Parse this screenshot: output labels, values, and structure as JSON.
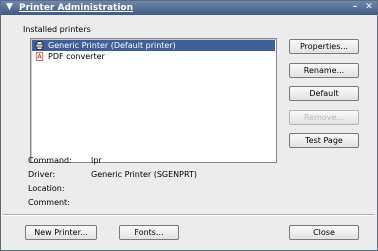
{
  "window": {
    "title": "Printer Administration",
    "minimize_label": "–",
    "close_label": "✕"
  },
  "installed_printers_label": "Installed printers",
  "printers": [
    {
      "name": "Generic Printer (Default printer)",
      "icon": "printer-icon",
      "selected": true
    },
    {
      "name": "PDF converter",
      "icon": "pdf-icon",
      "selected": false
    }
  ],
  "actions": {
    "properties": "Properties...",
    "rename": "Rename...",
    "default": "Default",
    "remove": "Remove...",
    "test_page": "Test Page"
  },
  "details": {
    "command_label": "Command:",
    "command_value": "lpr",
    "driver_label": "Driver:",
    "driver_value": "Generic Printer (SGENPRT)",
    "location_label": "Location:",
    "location_value": "",
    "comment_label": "Comment:",
    "comment_value": ""
  },
  "bottom": {
    "new_printer": "New Printer...",
    "fonts": "Fonts...",
    "close": "Close"
  },
  "colors": {
    "titlebar": "#3f5a84",
    "selection": "#3e5f9a",
    "background": "#ececec"
  }
}
